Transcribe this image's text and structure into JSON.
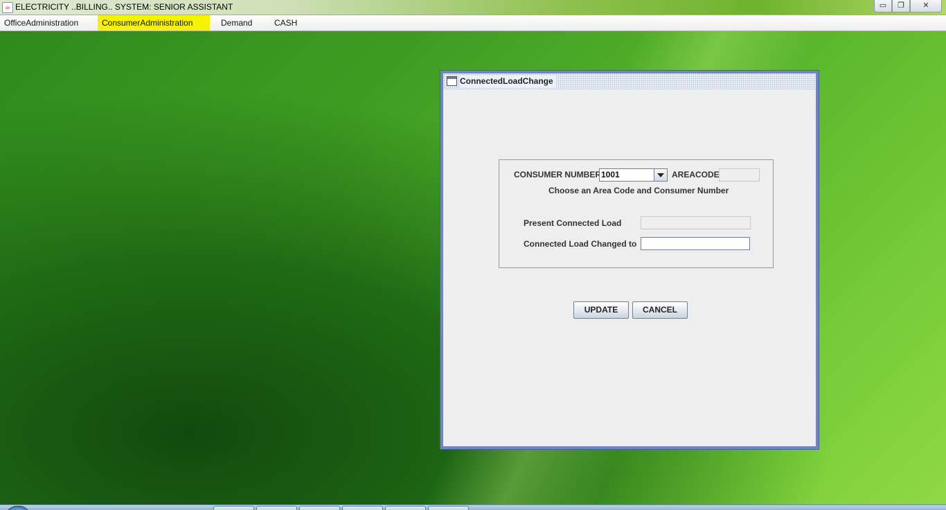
{
  "window": {
    "title": "ELECTRICITY ..BILLING.. SYSTEM: SENIOR ASSISTANT",
    "controls": {
      "minimize": "▭",
      "maximize": "❐",
      "close": "✕"
    }
  },
  "menubar": {
    "items": [
      {
        "label": "OfficeAdministration"
      },
      {
        "label": "ConsumerAdministration",
        "highlighted": true
      },
      {
        "label": "Demand"
      },
      {
        "label": "CASH"
      }
    ]
  },
  "dialog": {
    "title": "ConnectedLoadChange",
    "consumer_number_label": "CONSUMER NUMBER",
    "consumer_number_value": "1001",
    "areacode_label": "AREACODE",
    "areacode_value": "",
    "hint": "Choose an Area Code and Consumer Number",
    "present_load_label": "Present Connected Load",
    "present_load_value": "",
    "changed_to_label": "Connected Load Changed to",
    "changed_to_value": "",
    "update_label": "UPDATE",
    "cancel_label": "CANCEL"
  },
  "colors": {
    "menu_highlight": "#f5f300",
    "frame_border": "#6f86c0",
    "panel_bg": "#eeeeee"
  }
}
